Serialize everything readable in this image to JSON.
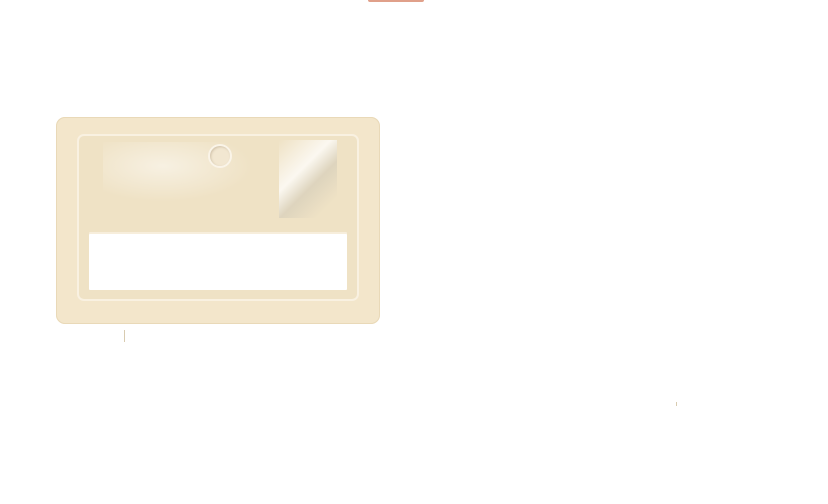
{
  "colors": {
    "background": "#ffffff",
    "card": "#f3e6cb",
    "accent": "#e0a08a",
    "label_window": "#ffffff"
  },
  "label_holder": {
    "label_text": ""
  }
}
